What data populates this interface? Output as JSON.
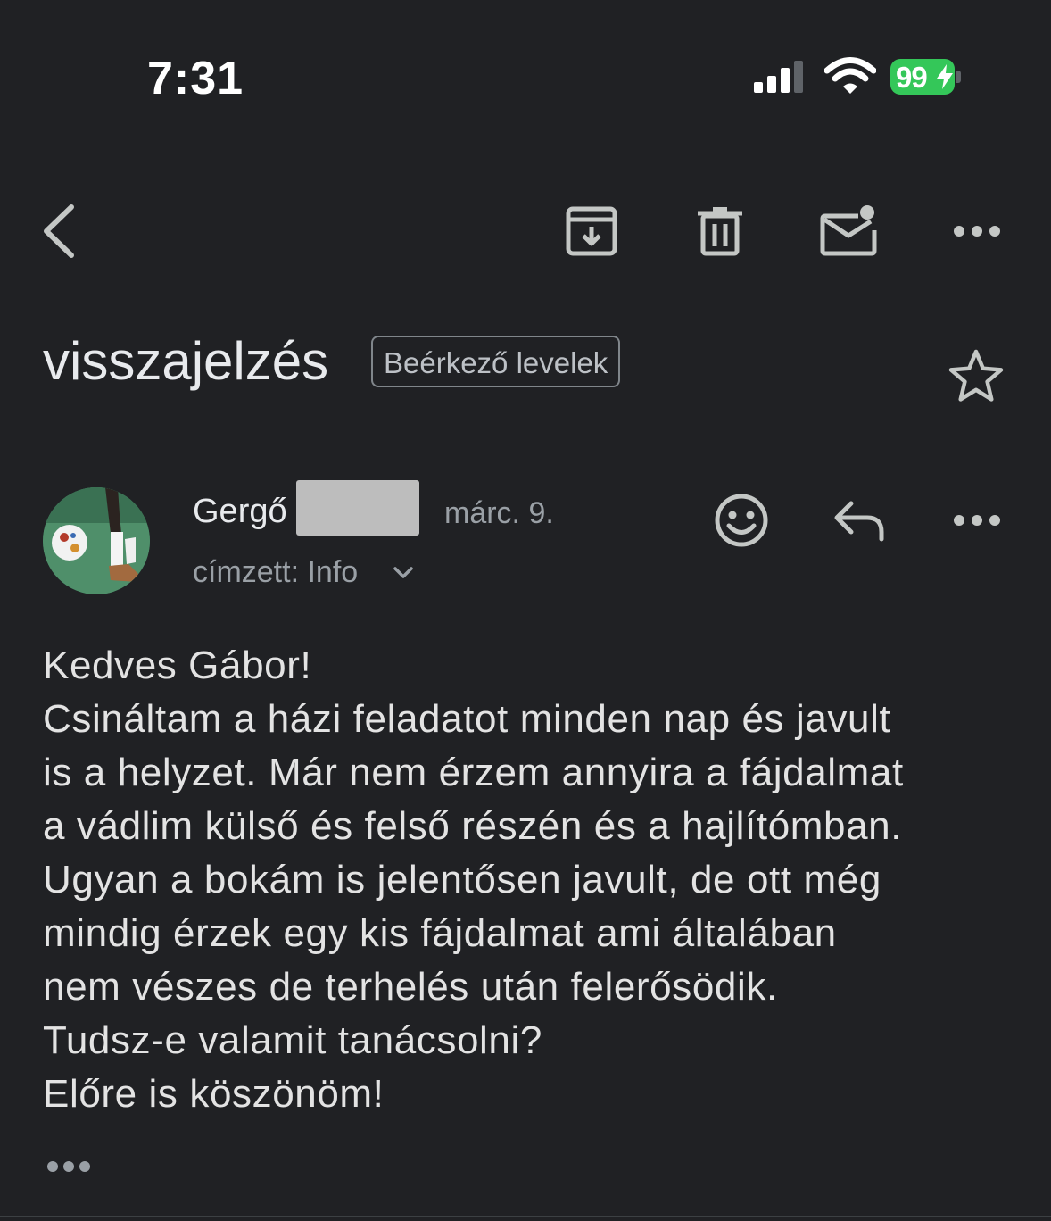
{
  "status_bar": {
    "time": "7:31",
    "battery_percent": "99",
    "battery_level": 0.99,
    "battery_color": "#34c759",
    "charging": true,
    "icons": [
      "cellular-signal-icon",
      "wifi-icon",
      "battery-icon"
    ]
  },
  "toolbar": {
    "icons": [
      "back-arrow-icon",
      "archive-icon",
      "trash-icon",
      "mark-unread-icon",
      "more-horizontal-icon"
    ]
  },
  "email": {
    "subject": "visszajelzés",
    "label": "Beérkező levelek",
    "starred": false,
    "sender": {
      "name": "Gergő",
      "name_redacted": true,
      "date": "márc. 9.",
      "recipient": "címzett: Info"
    },
    "body_lines": [
      "Kedves Gábor!",
      "Csináltam a házi feladatot minden nap és javult",
      "is a helyzet. Már nem érzem annyira a fájdalmat",
      "a vádlim külső és felső részén és a hajlítómban.",
      "Ugyan a bokám is jelentősen javult, de ott még",
      "mindig érzek egy kis fájdalmat ami általában",
      "nem vészes de terhelés után felerősödik.",
      "Tudsz-e valamit tanácsolni?",
      "Előre is köszönöm!"
    ]
  },
  "colors": {
    "background": "#202124",
    "text": "#e3e3e3",
    "muted_text": "#9aa0a6",
    "icon": "#c4c7c5"
  }
}
